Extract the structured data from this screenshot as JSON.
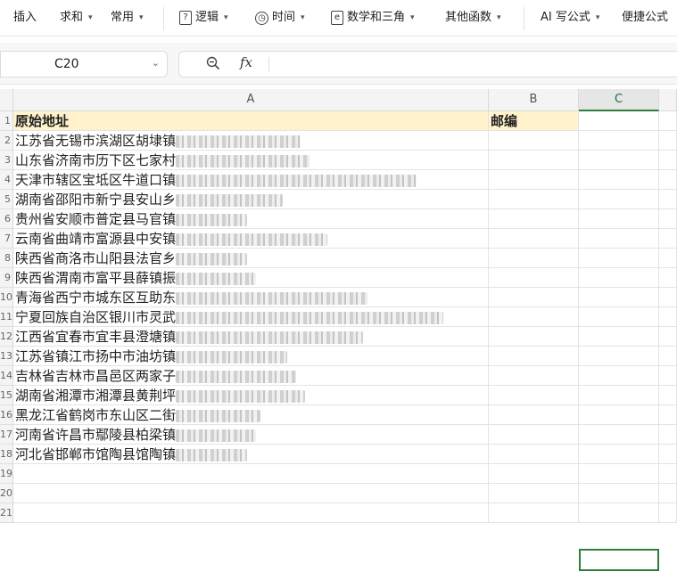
{
  "toolbar": {
    "insert": "插入",
    "sum": "求和",
    "common": "常用",
    "logic": "逻辑",
    "time": "时间",
    "math": "数学和三角",
    "other": "其他函数",
    "ai": "AI 写公式",
    "shortcut": "便捷公式"
  },
  "formula_bar": {
    "name_box": "C20",
    "fx_icon": "fx",
    "value": ""
  },
  "columns": [
    "A",
    "B",
    "C"
  ],
  "header_row": {
    "row": "1",
    "a": "原始地址",
    "b": "邮编"
  },
  "rows": [
    {
      "row": "2",
      "text": "江苏省无锡市滨湖区胡埭镇"
    },
    {
      "row": "3",
      "text": "山东省济南市历下区七家村"
    },
    {
      "row": "4",
      "text": "天津市辖区宝坻区牛道口镇"
    },
    {
      "row": "5",
      "text": "湖南省邵阳市新宁县安山乡"
    },
    {
      "row": "6",
      "text": "贵州省安顺市普定县马官镇"
    },
    {
      "row": "7",
      "text": "云南省曲靖市富源县中安镇"
    },
    {
      "row": "8",
      "text": "陕西省商洛市山阳县法官乡"
    },
    {
      "row": "9",
      "text": "陕西省渭南市富平县薛镇振"
    },
    {
      "row": "10",
      "text": "青海省西宁市城东区互助东"
    },
    {
      "row": "11",
      "text": "宁夏回族自治区银川市灵武"
    },
    {
      "row": "12",
      "text": "江西省宜春市宜丰县澄塘镇"
    },
    {
      "row": "13",
      "text": "江苏省镇江市扬中市油坊镇"
    },
    {
      "row": "14",
      "text": "吉林省吉林市昌邑区两家子"
    },
    {
      "row": "15",
      "text": "湖南省湘潭市湘潭县黄荆坪"
    },
    {
      "row": "16",
      "text": "黑龙江省鹤岗市东山区二街"
    },
    {
      "row": "17",
      "text": "河南省许昌市鄢陵县柏梁镇"
    },
    {
      "row": "18",
      "text": "河北省邯郸市馆陶县馆陶镇"
    },
    {
      "row": "19",
      "text": ""
    },
    {
      "row": "20",
      "text": ""
    },
    {
      "row": "21",
      "text": ""
    }
  ],
  "colors": {
    "accent": "#2f7d3a",
    "header_fill": "#fff2cc"
  }
}
